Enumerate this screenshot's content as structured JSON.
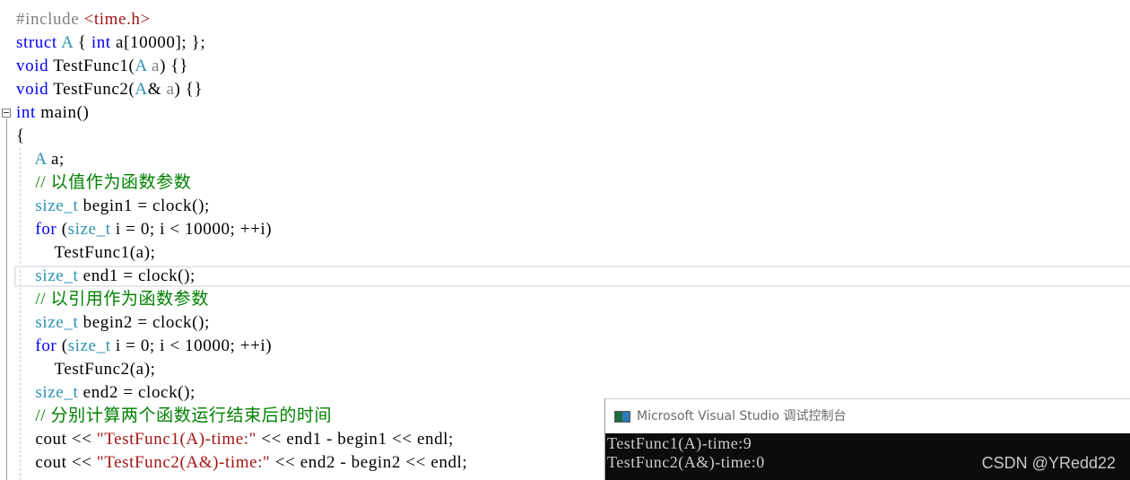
{
  "editor": {
    "lines": [
      {
        "indent": "",
        "tokens": [
          {
            "t": "#include ",
            "c": "pp"
          },
          {
            "t": "<time.h>",
            "c": "str"
          }
        ]
      },
      {
        "indent": "",
        "tokens": [
          {
            "t": "struct ",
            "c": "kw"
          },
          {
            "t": "A",
            "c": "ty"
          },
          {
            "t": " { ",
            "c": ""
          },
          {
            "t": "int",
            "c": "kw"
          },
          {
            "t": " a[10000]; };",
            "c": ""
          }
        ]
      },
      {
        "indent": "",
        "tokens": [
          {
            "t": "void",
            "c": "kw"
          },
          {
            "t": " TestFunc1(",
            "c": ""
          },
          {
            "t": "A",
            "c": "ty"
          },
          {
            "t": " a",
            "c": "op"
          },
          {
            "t": ") {}",
            "c": ""
          }
        ]
      },
      {
        "indent": "",
        "tokens": [
          {
            "t": "void",
            "c": "kw"
          },
          {
            "t": " TestFunc2(",
            "c": ""
          },
          {
            "t": "A",
            "c": "ty"
          },
          {
            "t": "& ",
            "c": ""
          },
          {
            "t": "a",
            "c": "op"
          },
          {
            "t": ") {}",
            "c": ""
          }
        ]
      },
      {
        "indent": "",
        "tokens": [
          {
            "t": "int",
            "c": "kw"
          },
          {
            "t": " main()",
            "c": ""
          }
        ]
      },
      {
        "indent": "",
        "tokens": [
          {
            "t": "{",
            "c": ""
          }
        ]
      },
      {
        "indent": "    ",
        "tokens": [
          {
            "t": "A",
            "c": "ty"
          },
          {
            "t": " a;",
            "c": ""
          }
        ]
      },
      {
        "indent": "    ",
        "tokens": [
          {
            "t": "// 以值作为函数参数",
            "c": "cm"
          }
        ]
      },
      {
        "indent": "    ",
        "tokens": [
          {
            "t": "size_t",
            "c": "ty"
          },
          {
            "t": " begin1 = clock();",
            "c": ""
          }
        ]
      },
      {
        "indent": "    ",
        "tokens": [
          {
            "t": "for",
            "c": "kw"
          },
          {
            "t": " (",
            "c": ""
          },
          {
            "t": "size_t",
            "c": "ty"
          },
          {
            "t": " i = 0; i < 10000; ++i)",
            "c": ""
          }
        ]
      },
      {
        "indent": "        ",
        "tokens": [
          {
            "t": "TestFunc1(a);",
            "c": ""
          }
        ]
      },
      {
        "indent": "    ",
        "tokens": [
          {
            "t": "size_t",
            "c": "ty"
          },
          {
            "t": " end1 = clock();",
            "c": ""
          }
        ]
      },
      {
        "indent": "    ",
        "tokens": [
          {
            "t": "// 以引用作为函数参数",
            "c": "cm"
          }
        ]
      },
      {
        "indent": "    ",
        "tokens": [
          {
            "t": "size_t",
            "c": "ty"
          },
          {
            "t": " begin2 = clock();",
            "c": ""
          }
        ]
      },
      {
        "indent": "    ",
        "tokens": [
          {
            "t": "for",
            "c": "kw"
          },
          {
            "t": " (",
            "c": ""
          },
          {
            "t": "size_t",
            "c": "ty"
          },
          {
            "t": " i = 0; i < 10000; ++i)",
            "c": ""
          }
        ]
      },
      {
        "indent": "        ",
        "tokens": [
          {
            "t": "TestFunc2(a);",
            "c": ""
          }
        ]
      },
      {
        "indent": "    ",
        "tokens": [
          {
            "t": "size_t",
            "c": "ty"
          },
          {
            "t": " end2 = clock();",
            "c": ""
          }
        ]
      },
      {
        "indent": "    ",
        "tokens": [
          {
            "t": "// 分别计算两个函数运行结束后的时间",
            "c": "cm"
          }
        ]
      },
      {
        "indent": "    ",
        "tokens": [
          {
            "t": "cout << ",
            "c": ""
          },
          {
            "t": "\"TestFunc1(A)-time:\"",
            "c": "str"
          },
          {
            "t": " << end1 - begin1 << endl;",
            "c": ""
          }
        ]
      },
      {
        "indent": "    ",
        "tokens": [
          {
            "t": "cout << ",
            "c": ""
          },
          {
            "t": "\"TestFunc2(A&)-time:\"",
            "c": "str"
          },
          {
            "t": " << end2 - begin2 << endl;",
            "c": ""
          }
        ]
      }
    ]
  },
  "console": {
    "title": "Microsoft Visual Studio 调试控制台",
    "icon": "console-window-icon",
    "output": [
      "TestFunc1(A)-time:9",
      "TestFunc2(A&)-time:0"
    ]
  },
  "watermark": "CSDN @YRedd22"
}
